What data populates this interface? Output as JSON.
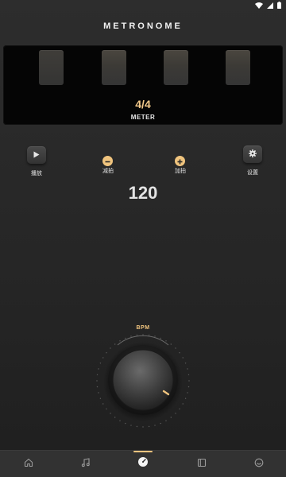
{
  "app": {
    "title": "METRONOME"
  },
  "meter": {
    "value": "4/4",
    "label": "METER",
    "beats": 4
  },
  "controls": {
    "play_label": "播放",
    "decrease_label": "减拍",
    "increase_label": "加拍",
    "settings_label": "设置"
  },
  "tempo": {
    "bpm": "120",
    "dial_label": "BPM"
  },
  "bottom_nav": {
    "items": [
      "home-icon",
      "music-note-icon",
      "metronome-icon",
      "book-icon",
      "smile-icon"
    ],
    "active_index": 2
  },
  "colors": {
    "accent": "#f0c47e",
    "meter_value": "#f3c98a",
    "background": "#2b2b2b",
    "panel": "#050505"
  }
}
